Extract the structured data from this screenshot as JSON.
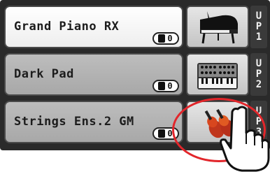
{
  "slots": [
    {
      "name": "Grand Piano RX",
      "io_label": "0",
      "icon": "grand-piano-icon",
      "tag": [
        "U",
        "P",
        "1"
      ],
      "selected": true
    },
    {
      "name": "Dark Pad",
      "io_label": "0",
      "icon": "synth-keyboard-icon",
      "tag": [
        "U",
        "P",
        "2"
      ],
      "selected": false
    },
    {
      "name": "Strings Ens.2 GM",
      "io_label": "0",
      "icon": "violin-icon",
      "tag": [
        "U",
        "P",
        "3"
      ],
      "selected": false
    }
  ],
  "colors": {
    "highlight": "#e2262b",
    "panel": "#2a2a2a"
  }
}
